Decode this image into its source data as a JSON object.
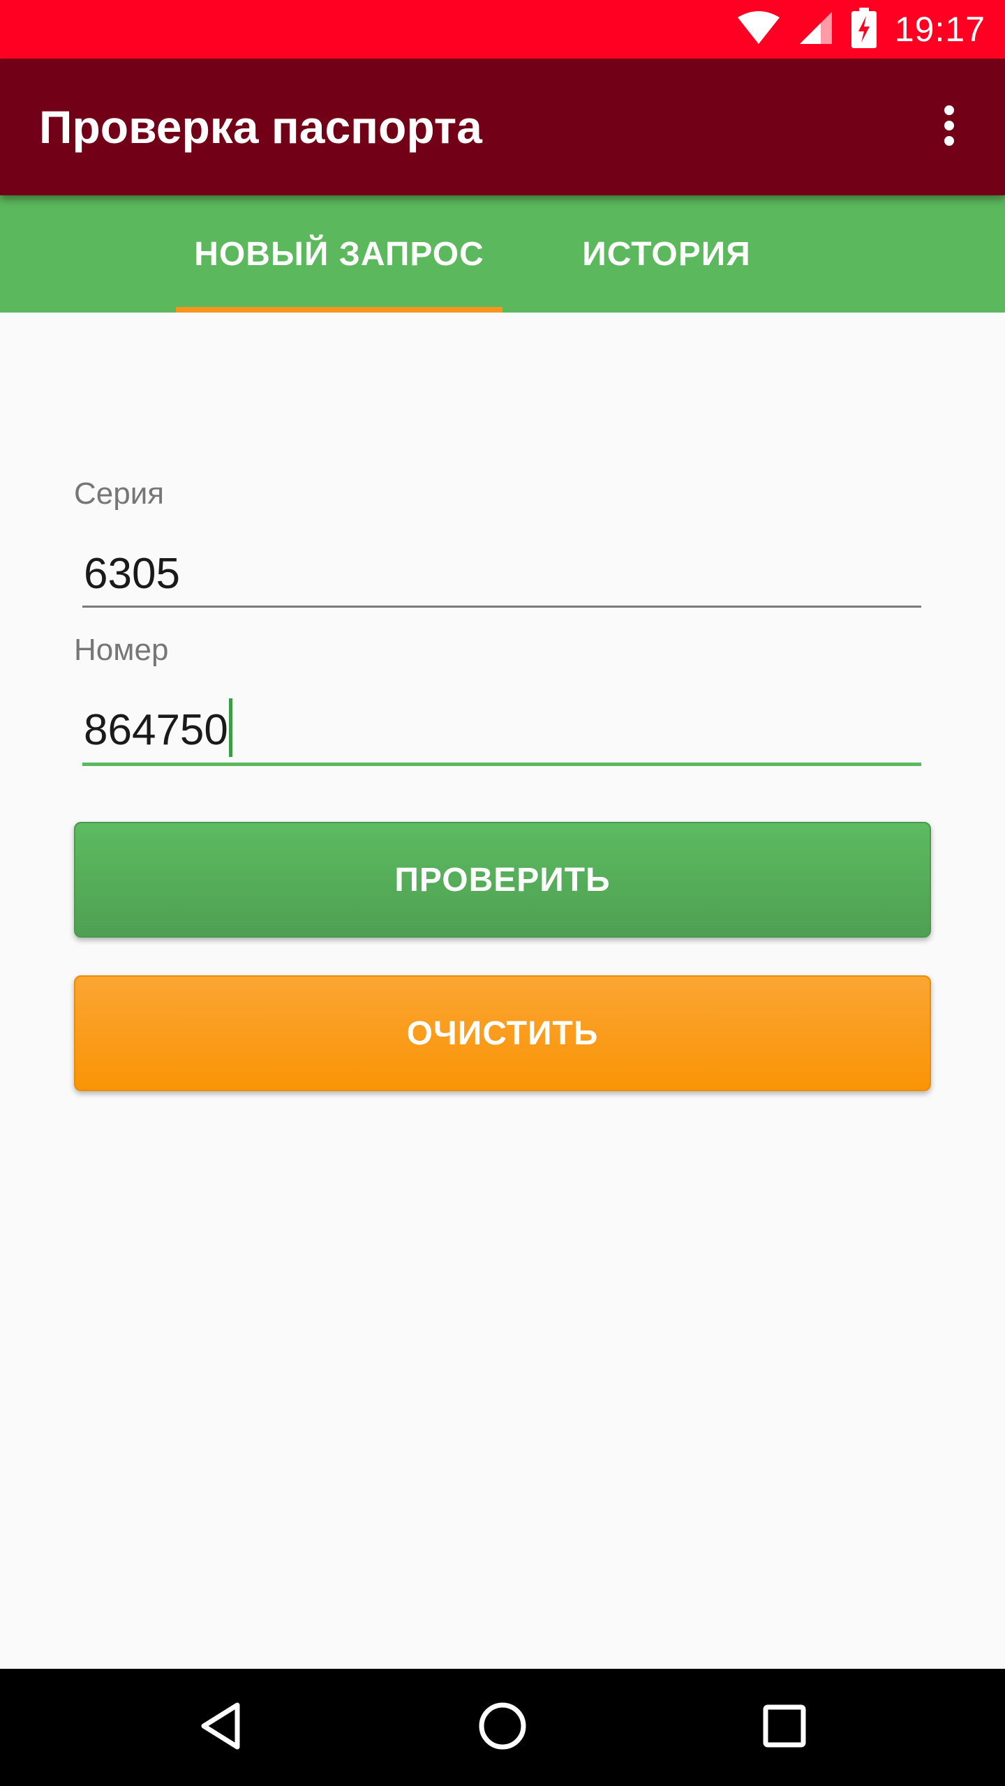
{
  "status_bar": {
    "time": "19:17",
    "icons": [
      "wifi-icon",
      "cell-signal-icon",
      "battery-charging-icon"
    ],
    "background": "#ff0022"
  },
  "app_bar": {
    "title": "Проверка паспорта",
    "menu_icon": "more-vert-icon",
    "background": "#720016"
  },
  "tabs": {
    "items": [
      {
        "label": "НОВЫЙ ЗАПРОС",
        "selected": true
      },
      {
        "label": "ИСТОРИЯ",
        "selected": false
      }
    ],
    "background": "#5cb85c",
    "indicator_color": "#f7941d"
  },
  "form": {
    "series": {
      "label": "Серия",
      "value": "6305"
    },
    "number": {
      "label": "Номер",
      "value": "864750"
    }
  },
  "buttons": {
    "check": {
      "label": "ПРОВЕРИТЬ",
      "color": "#5cb85c"
    },
    "clear": {
      "label": "ОЧИСТИТЬ",
      "color": "#f99a14"
    }
  },
  "nav_bar": {
    "icons": [
      "back-icon",
      "home-icon",
      "recents-icon"
    ]
  }
}
